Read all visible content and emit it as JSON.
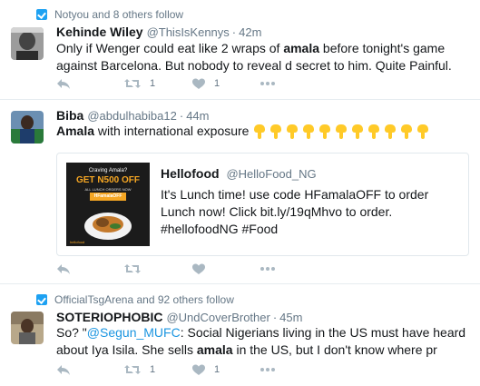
{
  "tweets": [
    {
      "context": "Notyou and 8 others follow",
      "fullname": "Kehinde Wiley",
      "username": "@ThisIsKennys",
      "time": "42m",
      "text_parts": [
        "Only if Wenger could eat like 2 wraps of ",
        "amala",
        " before tonight's game against Barcelona. But nobody to reveal d secret to him. Quite Painful."
      ],
      "retweets": "1",
      "likes": "1"
    },
    {
      "fullname": "Biba",
      "username": "@abdulhabiba12",
      "time": "44m",
      "text_parts": [
        "Amala",
        " with international exposure"
      ],
      "emoji_count": 11,
      "emoji_name": "pointing-down-icon",
      "card": {
        "fullname": "Hellofood",
        "username": "@HelloFood_NG",
        "text": "It's Lunch time! use code HFamalaOFF to order Lunch now! Click bit.ly/19qMhvo to order. #hellofoodNG #Food",
        "image": {
          "tagline": "Craving Amala?",
          "offer": "GET N500 OFF",
          "sub": "ALL LUNCH ORDERS NOW",
          "code": "HFamalaOFF",
          "brand": "hellofood"
        }
      }
    },
    {
      "context": "OfficialTsgArena and 92 others follow",
      "fullname": "SOTERIOPHOBIC",
      "username": "@UndCoverBrother",
      "time": "45m",
      "text_parts": [
        "So? \"",
        "@Segun_MUFC",
        ": Social Nigerians living in the US must have heard about Iya Isila. She sells ",
        "amala",
        " in the US, but I don't know where pr"
      ],
      "retweets": "1",
      "likes": "1"
    }
  ],
  "colors": {
    "accent": "#1da1f2",
    "mention": "#1b95e0",
    "muted": "#657786",
    "icon": "#aab8c2",
    "emoji": "#ffca28",
    "offer": "#f5a623"
  }
}
